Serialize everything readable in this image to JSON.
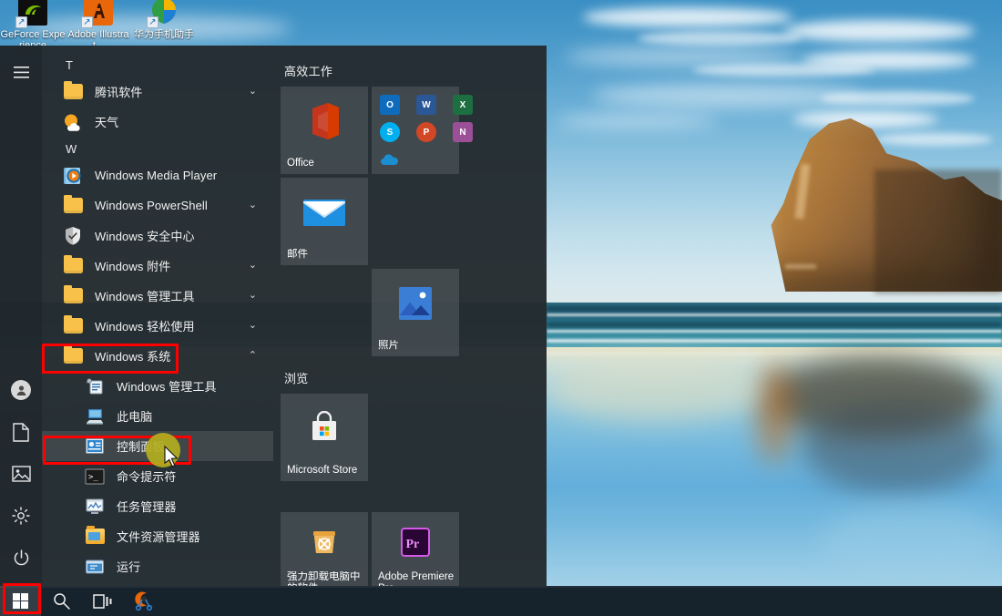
{
  "desktop": {
    "icons": [
      {
        "label": "GeForce Experience",
        "icon": "geforce-icon"
      },
      {
        "label": "Adobe Illustrat...",
        "icon": "adobe-illustrator-icon"
      },
      {
        "label": "华为手机助手",
        "icon": "huawei-phone-assistant-icon"
      }
    ],
    "wallpaper_name": "windows-10-hero-wharariki-beach"
  },
  "start_menu": {
    "hamburger_label": "展开",
    "rail": [
      {
        "name": "user-account",
        "icon": "person-icon"
      },
      {
        "name": "documents",
        "icon": "document-icon"
      },
      {
        "name": "pictures",
        "icon": "picture-icon"
      },
      {
        "name": "settings",
        "icon": "gear-icon"
      },
      {
        "name": "power",
        "icon": "power-icon"
      }
    ],
    "app_list": [
      {
        "type": "alpha",
        "label": "T"
      },
      {
        "type": "folder",
        "label": "腾讯软件",
        "icon": "folder-icon",
        "chevron": "⌄"
      },
      {
        "type": "app",
        "label": "天气",
        "icon": "weather-icon"
      },
      {
        "type": "alpha",
        "label": "W"
      },
      {
        "type": "app",
        "label": "Windows Media Player",
        "icon": "media-player-icon"
      },
      {
        "type": "folder",
        "label": "Windows PowerShell",
        "icon": "folder-icon",
        "chevron": "⌄"
      },
      {
        "type": "app",
        "label": "Windows 安全中心",
        "icon": "shield-icon"
      },
      {
        "type": "folder",
        "label": "Windows 附件",
        "icon": "folder-icon",
        "chevron": "⌄"
      },
      {
        "type": "folder",
        "label": "Windows 管理工具",
        "icon": "folder-icon",
        "chevron": "⌄"
      },
      {
        "type": "folder",
        "label": "Windows 轻松使用",
        "icon": "folder-icon",
        "chevron": "⌄"
      },
      {
        "type": "folder",
        "label": "Windows 系统",
        "icon": "folder-open-icon",
        "chevron": "⌃",
        "expanded": true,
        "highlighted": true
      },
      {
        "type": "sub",
        "label": "Windows 管理工具",
        "icon": "admin-tools-icon"
      },
      {
        "type": "sub",
        "label": "此电脑",
        "icon": "this-pc-icon"
      },
      {
        "type": "sub",
        "label": "控制面板",
        "icon": "control-panel-icon",
        "highlighted": true,
        "hovered": true
      },
      {
        "type": "sub",
        "label": "命令提示符",
        "icon": "command-prompt-icon"
      },
      {
        "type": "sub",
        "label": "任务管理器",
        "icon": "task-manager-icon"
      },
      {
        "type": "sub",
        "label": "文件资源管理器",
        "icon": "file-explorer-icon"
      },
      {
        "type": "sub",
        "label": "运行",
        "icon": "run-icon"
      }
    ],
    "tile_groups": [
      {
        "title": "高效工作",
        "tiles": [
          {
            "label": "Office",
            "icon": "office-icon",
            "size": "md"
          },
          {
            "label": "",
            "icon": "office-365-live-tile",
            "size": "md",
            "office_apps": [
              {
                "name": "Outlook",
                "letter": "O",
                "color": "#2b7cd3"
              },
              {
                "name": "Word",
                "letter": "W",
                "color": "#2b5797"
              },
              {
                "name": "Excel",
                "letter": "X",
                "color": "#1d6f42"
              },
              {
                "name": "Skype",
                "letter": "S",
                "color": "#00aff0"
              },
              {
                "name": "PowerPoint",
                "letter": "P",
                "color": "#d24726"
              },
              {
                "name": "OneNote",
                "letter": "N",
                "color": "#80397b"
              },
              {
                "name": "OneDrive",
                "letter": "",
                "color": "#1a8ed1"
              }
            ]
          },
          {
            "label": "邮件",
            "icon": "mail-icon",
            "size": "md"
          },
          {
            "label": "照片",
            "icon": "photos-icon",
            "size": "md"
          }
        ]
      },
      {
        "title": "浏览",
        "tiles": [
          {
            "label": "Microsoft Store",
            "icon": "microsoft-store-icon",
            "size": "md"
          },
          {
            "label": "强力卸载电脑中的软件",
            "icon": "uninstaller-icon",
            "size": "md"
          },
          {
            "label": "Adobe Premiere Pro...",
            "icon": "premiere-pro-icon",
            "size": "md"
          }
        ]
      }
    ]
  },
  "taskbar": {
    "buttons": [
      {
        "name": "start-button",
        "icon": "windows-logo-icon",
        "active": true,
        "highlighted": true
      },
      {
        "name": "search-button",
        "icon": "search-icon"
      },
      {
        "name": "task-view-button",
        "icon": "task-view-icon"
      },
      {
        "name": "pinned-app",
        "icon": "utility-app-icon"
      }
    ]
  },
  "annotations": {
    "highlight_color": "#fe0000",
    "cursor_indicator_color": "#b3ae1e"
  }
}
